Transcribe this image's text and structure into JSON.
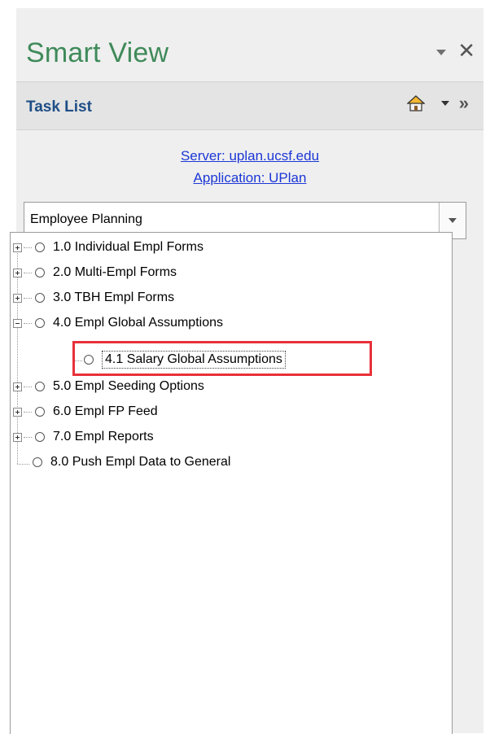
{
  "panel": {
    "title": "Smart View"
  },
  "tasklist": {
    "label": "Task List"
  },
  "connection": {
    "server": "Server: uplan.ucsf.edu",
    "application": "Application: UPlan"
  },
  "dropdown": {
    "selected": "Employee Planning"
  },
  "tree": {
    "items": [
      {
        "label": "1.0 Individual Empl Forms",
        "expander": "plus"
      },
      {
        "label": "2.0 Multi-Empl Forms",
        "expander": "plus"
      },
      {
        "label": "3.0 TBH Empl Forms",
        "expander": "plus"
      },
      {
        "label": "4.0 Empl Global Assumptions",
        "expander": "minus"
      },
      {
        "label": "4.1 Salary Global Assumptions",
        "expander": "none",
        "selected": true
      },
      {
        "label": "5.0 Empl Seeding Options",
        "expander": "plus"
      },
      {
        "label": "6.0 Empl FP Feed",
        "expander": "plus"
      },
      {
        "label": "7.0 Empl Reports",
        "expander": "plus"
      },
      {
        "label": "8.0 Push Empl Data to General",
        "expander": "none"
      }
    ]
  },
  "colors": {
    "title": "#3f8a5a",
    "link": "#1c37d6",
    "highlight": "#e8303a",
    "tasklist": "#1f4e86"
  },
  "icons": {
    "home": "home-icon",
    "more": "chevron-double-right-icon",
    "close": "close-icon"
  }
}
